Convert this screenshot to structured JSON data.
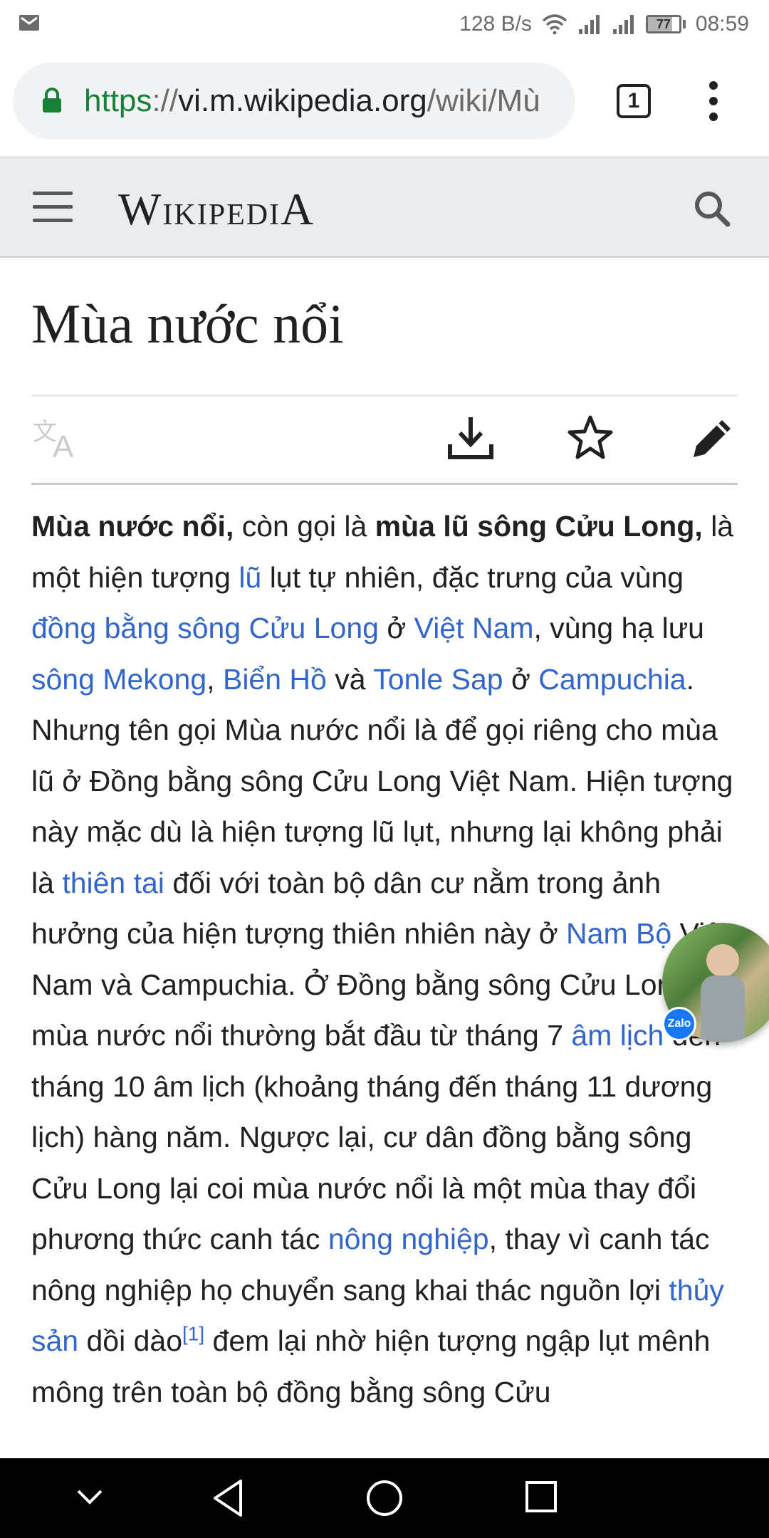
{
  "status_bar": {
    "net_speed": "128 B/s",
    "battery": "77",
    "time": "08:59"
  },
  "browser": {
    "url_scheme": "https",
    "url_sep": "://",
    "url_host": "vi.m.wikipedia.org",
    "url_path": "/wiki/Mù",
    "tab_count": "1"
  },
  "wiki": {
    "wordmark_first": "W",
    "wordmark_mid": "ikipedi",
    "wordmark_last": "A"
  },
  "article": {
    "title": "Mùa nước nổi",
    "p": [
      {
        "b": "Mùa nước nổi,"
      },
      {
        "t": " còn gọi là "
      },
      {
        "b": "mùa lũ sông Cửu Long,"
      },
      {
        "t": " là một hiện tượng "
      },
      {
        "a": "lũ"
      },
      {
        "t": " lụt tự nhiên, đặc trưng của vùng "
      },
      {
        "a": "đồng bằng sông Cửu Long"
      },
      {
        "t": " ở "
      },
      {
        "a": "Việt Nam"
      },
      {
        "t": ", vùng hạ lưu "
      },
      {
        "a": "sông Mekong"
      },
      {
        "t": ", "
      },
      {
        "a": "Biển Hồ"
      },
      {
        "t": " và "
      },
      {
        "a": "Tonle Sap"
      },
      {
        "t": " ở "
      },
      {
        "a": "Campuchia"
      },
      {
        "t": ". Nhưng tên gọi Mùa nước nổi là để gọi riêng cho mùa lũ ở Đồng bằng sông Cửu Long Việt Nam. Hiện tượng này mặc dù là hiện tượng lũ lụt, nhưng lại không phải là "
      },
      {
        "a": "thiên tai"
      },
      {
        "t": " đối với toàn bộ dân cư nằm trong ảnh hưởng của hiện tượng thiên nhiên này ở "
      },
      {
        "a": "Nam Bộ"
      },
      {
        "t": " Việt Nam và Campuchia. Ở Đồng bằng sông Cửu Long, mùa nước nổi thường bắt đầu từ tháng 7 "
      },
      {
        "a": "âm lịch"
      },
      {
        "t": " đến tháng 10 âm lịch (khoảng tháng đến tháng 11 dương lịch) hàng năm. Ngược lại, cư dân đồng bằng sông Cửu Long lại coi mùa nước nổi là một mùa thay đổi phương thức canh tác "
      },
      {
        "a": "nông nghiệp"
      },
      {
        "t": ", thay vì canh tác nông nghiệp họ chuyển sang khai thác nguồn lợi "
      },
      {
        "a": "thủy sản"
      },
      {
        "t": " dồi dào"
      },
      {
        "sup": "[1]"
      },
      {
        "t": " đem lại nhờ hiện tượng ngập lụt mênh mông trên toàn bộ đồng bằng sông Cửu"
      }
    ]
  },
  "chat_head": {
    "badge": "Zalo"
  }
}
